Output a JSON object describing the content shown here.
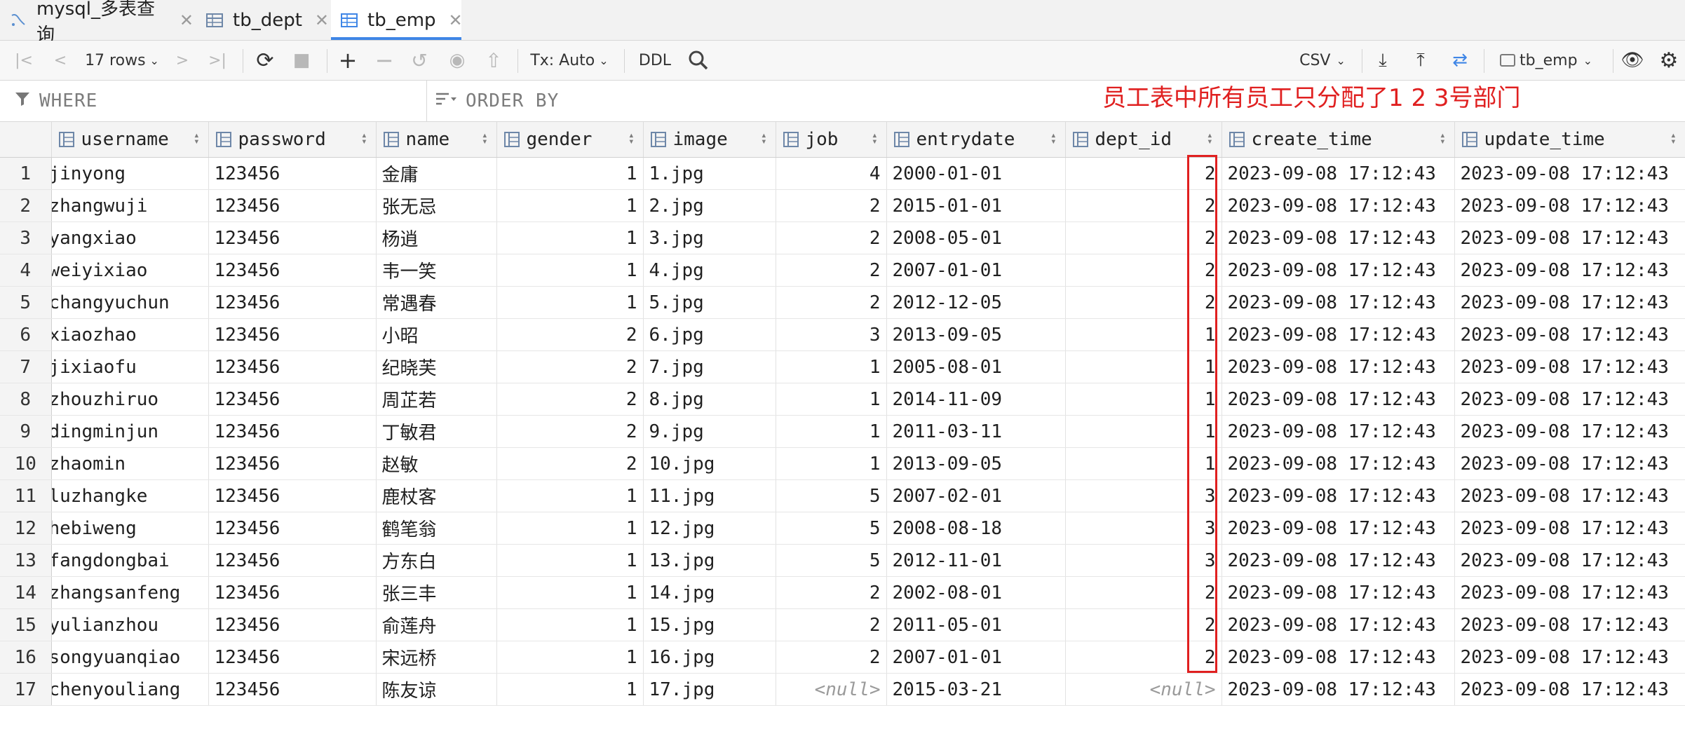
{
  "tabs": [
    {
      "label": "mysql_多表查询",
      "icon": "console-icon",
      "active": false
    },
    {
      "label": "tb_dept",
      "icon": "table-icon",
      "active": false
    },
    {
      "label": "tb_emp",
      "icon": "table-icon",
      "active": true
    }
  ],
  "toolbar": {
    "rows_label": "17 rows",
    "tx_label": "Tx: Auto",
    "ddl_label": "DDL",
    "csv_label": "CSV",
    "datasource_label": "tb_emp"
  },
  "filter": {
    "where_label": "WHERE",
    "order_label": "ORDER BY"
  },
  "annotation": "员工表中所有员工只分配了1 2 3号部门",
  "colors": {
    "accent": "#3f86e6",
    "annotation": "#e02020"
  },
  "columns": [
    "username",
    "password",
    "name",
    "gender",
    "image",
    "job",
    "entrydate",
    "dept_id",
    "create_time",
    "update_time"
  ],
  "rows": [
    {
      "n": "1",
      "username": "jinyong",
      "password": "123456",
      "name": "金庸",
      "gender": "1",
      "image": "1.jpg",
      "job": "4",
      "entrydate": "2000-01-01",
      "dept_id": "2",
      "create_time": "2023-09-08 17:12:43",
      "update_time": "2023-09-08 17:12:43"
    },
    {
      "n": "2",
      "username": "zhangwuji",
      "password": "123456",
      "name": "张无忌",
      "gender": "1",
      "image": "2.jpg",
      "job": "2",
      "entrydate": "2015-01-01",
      "dept_id": "2",
      "create_time": "2023-09-08 17:12:43",
      "update_time": "2023-09-08 17:12:43"
    },
    {
      "n": "3",
      "username": "yangxiao",
      "password": "123456",
      "name": "杨逍",
      "gender": "1",
      "image": "3.jpg",
      "job": "2",
      "entrydate": "2008-05-01",
      "dept_id": "2",
      "create_time": "2023-09-08 17:12:43",
      "update_time": "2023-09-08 17:12:43"
    },
    {
      "n": "4",
      "username": "weiyixiao",
      "password": "123456",
      "name": "韦一笑",
      "gender": "1",
      "image": "4.jpg",
      "job": "2",
      "entrydate": "2007-01-01",
      "dept_id": "2",
      "create_time": "2023-09-08 17:12:43",
      "update_time": "2023-09-08 17:12:43"
    },
    {
      "n": "5",
      "username": "changyuchun",
      "password": "123456",
      "name": "常遇春",
      "gender": "1",
      "image": "5.jpg",
      "job": "2",
      "entrydate": "2012-12-05",
      "dept_id": "2",
      "create_time": "2023-09-08 17:12:43",
      "update_time": "2023-09-08 17:12:43"
    },
    {
      "n": "6",
      "username": "xiaozhao",
      "password": "123456",
      "name": "小昭",
      "gender": "2",
      "image": "6.jpg",
      "job": "3",
      "entrydate": "2013-09-05",
      "dept_id": "1",
      "create_time": "2023-09-08 17:12:43",
      "update_time": "2023-09-08 17:12:43"
    },
    {
      "n": "7",
      "username": "jixiaofu",
      "password": "123456",
      "name": "纪晓芙",
      "gender": "2",
      "image": "7.jpg",
      "job": "1",
      "entrydate": "2005-08-01",
      "dept_id": "1",
      "create_time": "2023-09-08 17:12:43",
      "update_time": "2023-09-08 17:12:43"
    },
    {
      "n": "8",
      "username": "zhouzhiruo",
      "password": "123456",
      "name": "周芷若",
      "gender": "2",
      "image": "8.jpg",
      "job": "1",
      "entrydate": "2014-11-09",
      "dept_id": "1",
      "create_time": "2023-09-08 17:12:43",
      "update_time": "2023-09-08 17:12:43"
    },
    {
      "n": "9",
      "username": "dingminjun",
      "password": "123456",
      "name": "丁敏君",
      "gender": "2",
      "image": "9.jpg",
      "job": "1",
      "entrydate": "2011-03-11",
      "dept_id": "1",
      "create_time": "2023-09-08 17:12:43",
      "update_time": "2023-09-08 17:12:43"
    },
    {
      "n": "10",
      "username": "zhaomin",
      "password": "123456",
      "name": "赵敏",
      "gender": "2",
      "image": "10.jpg",
      "job": "1",
      "entrydate": "2013-09-05",
      "dept_id": "1",
      "create_time": "2023-09-08 17:12:43",
      "update_time": "2023-09-08 17:12:43"
    },
    {
      "n": "11",
      "username": "luzhangke",
      "password": "123456",
      "name": "鹿杖客",
      "gender": "1",
      "image": "11.jpg",
      "job": "5",
      "entrydate": "2007-02-01",
      "dept_id": "3",
      "create_time": "2023-09-08 17:12:43",
      "update_time": "2023-09-08 17:12:43"
    },
    {
      "n": "12",
      "username": "hebiweng",
      "password": "123456",
      "name": "鹤笔翁",
      "gender": "1",
      "image": "12.jpg",
      "job": "5",
      "entrydate": "2008-08-18",
      "dept_id": "3",
      "create_time": "2023-09-08 17:12:43",
      "update_time": "2023-09-08 17:12:43"
    },
    {
      "n": "13",
      "username": "fangdongbai",
      "password": "123456",
      "name": "方东白",
      "gender": "1",
      "image": "13.jpg",
      "job": "5",
      "entrydate": "2012-11-01",
      "dept_id": "3",
      "create_time": "2023-09-08 17:12:43",
      "update_time": "2023-09-08 17:12:43"
    },
    {
      "n": "14",
      "username": "zhangsanfeng",
      "password": "123456",
      "name": "张三丰",
      "gender": "1",
      "image": "14.jpg",
      "job": "2",
      "entrydate": "2002-08-01",
      "dept_id": "2",
      "create_time": "2023-09-08 17:12:43",
      "update_time": "2023-09-08 17:12:43"
    },
    {
      "n": "15",
      "username": "yulianzhou",
      "password": "123456",
      "name": "俞莲舟",
      "gender": "1",
      "image": "15.jpg",
      "job": "2",
      "entrydate": "2011-05-01",
      "dept_id": "2",
      "create_time": "2023-09-08 17:12:43",
      "update_time": "2023-09-08 17:12:43"
    },
    {
      "n": "16",
      "username": "songyuanqiao",
      "password": "123456",
      "name": "宋远桥",
      "gender": "1",
      "image": "16.jpg",
      "job": "2",
      "entrydate": "2007-01-01",
      "dept_id": "2",
      "create_time": "2023-09-08 17:12:43",
      "update_time": "2023-09-08 17:12:43"
    },
    {
      "n": "17",
      "username": "chenyouliang",
      "password": "123456",
      "name": "陈友谅",
      "gender": "1",
      "image": "17.jpg",
      "job": "<null>",
      "entrydate": "2015-03-21",
      "dept_id": "<null>",
      "create_time": "2023-09-08 17:12:43",
      "update_time": "2023-09-08 17:12:43"
    }
  ]
}
